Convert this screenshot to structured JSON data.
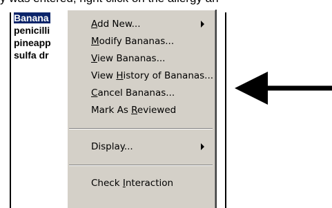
{
  "caption": "y was entered, right click on the allergy an",
  "allergy_list": {
    "items": [
      {
        "label": "Banana",
        "selected": true
      },
      {
        "label": "penicilli",
        "selected": false
      },
      {
        "label": "pineapp",
        "selected": false
      },
      {
        "label": "sulfa dr",
        "selected": false
      }
    ]
  },
  "context_menu": {
    "items": [
      {
        "pre": "",
        "accel": "A",
        "post": "dd New...",
        "submenu": true
      },
      {
        "pre": "",
        "accel": "M",
        "post": "odify Bananas...",
        "submenu": false
      },
      {
        "pre": "",
        "accel": "V",
        "post": "iew Bananas...",
        "submenu": false
      },
      {
        "pre": "View ",
        "accel": "H",
        "post": "istory of Bananas...",
        "submenu": false
      },
      {
        "pre": "",
        "accel": "C",
        "post": "ancel Bananas...",
        "submenu": false
      },
      {
        "pre": "Mark As ",
        "accel": "R",
        "post": "eviewed",
        "submenu": false
      },
      {
        "pre": "Display...",
        "accel": "",
        "post": "",
        "submenu": true
      },
      {
        "pre": "Check ",
        "accel": "I",
        "post": "nteraction",
        "submenu": false
      }
    ]
  },
  "icons": {
    "submenu_arrow": "triangle-right-icon",
    "pointer_arrow": "arrow-left-icon"
  },
  "colors": {
    "menu_background": "#d4d0c8",
    "selection_background": "#0a246a",
    "selection_text": "#ffffff"
  }
}
